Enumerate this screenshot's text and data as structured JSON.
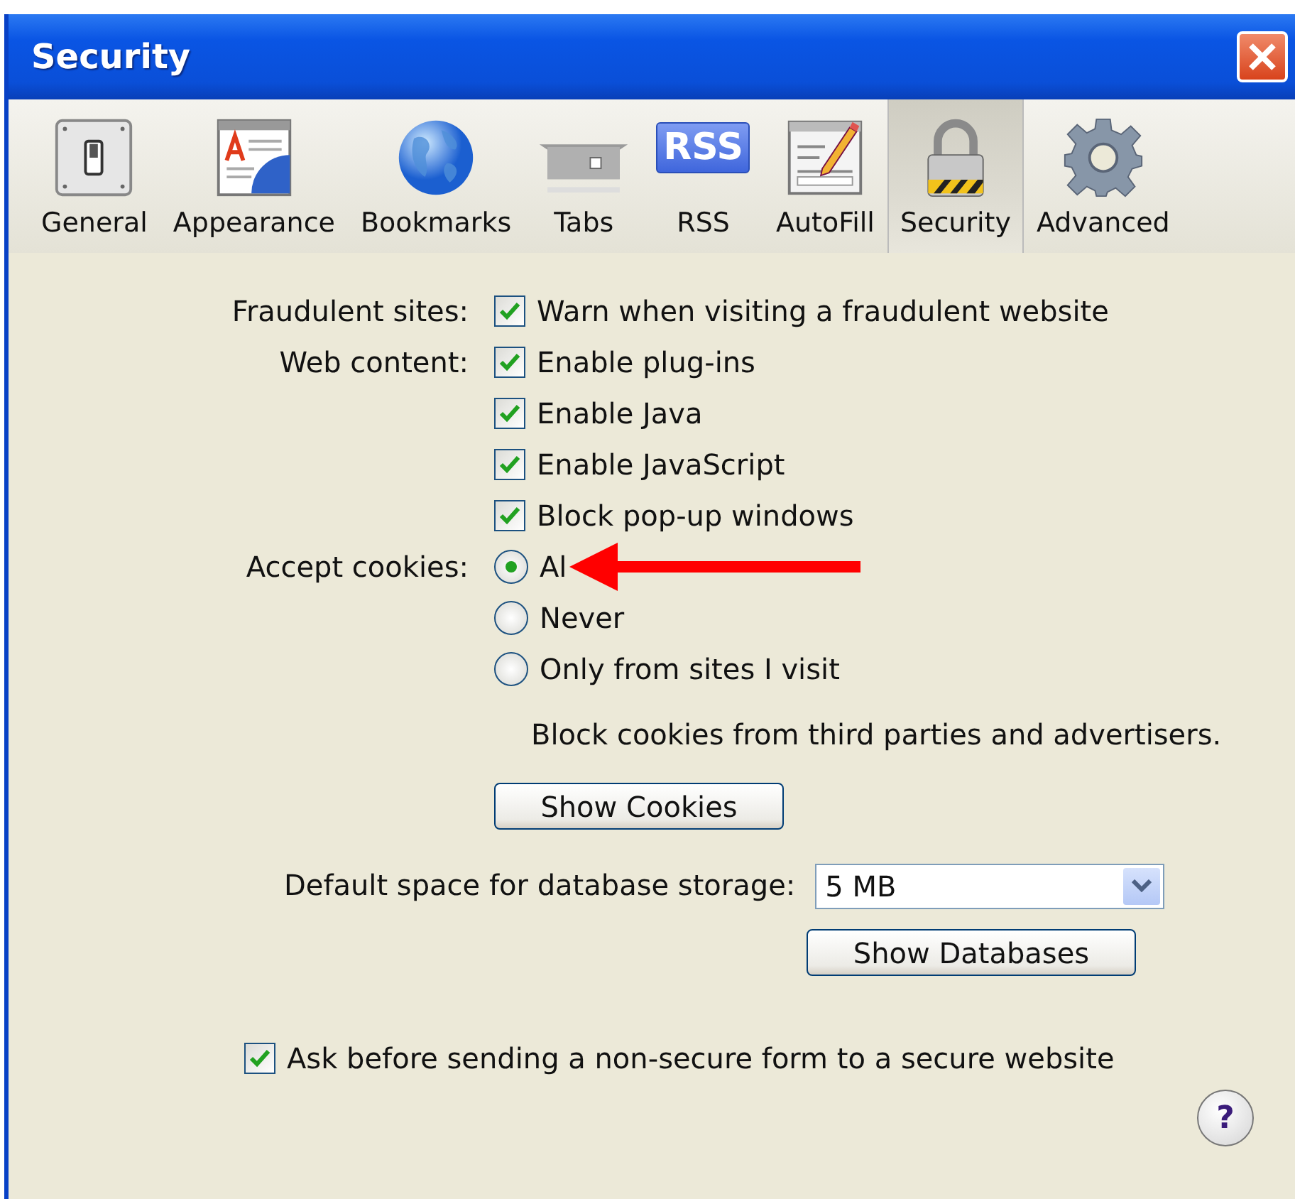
{
  "window": {
    "title": "Security"
  },
  "toolbar": [
    {
      "kind": "switch",
      "label": "General",
      "selected": false
    },
    {
      "kind": "appearance",
      "label": "Appearance",
      "selected": false
    },
    {
      "kind": "globe",
      "label": "Bookmarks",
      "selected": false
    },
    {
      "kind": "tray",
      "label": "Tabs",
      "selected": false
    },
    {
      "kind": "feed",
      "label": "RSS",
      "badge": "RSS",
      "selected": false
    },
    {
      "kind": "form",
      "label": "AutoFill",
      "selected": false
    },
    {
      "kind": "lock",
      "label": "Security",
      "selected": true
    },
    {
      "kind": "gear",
      "label": "Advanced",
      "selected": false
    }
  ],
  "fraudulent_sites": {
    "label": "Fraudulent sites:",
    "options": [
      {
        "label": "Warn when visiting a fraudulent website",
        "checked": true
      }
    ]
  },
  "web_content": {
    "label": "Web content:",
    "options": [
      {
        "label": "Enable plug-ins",
        "checked": true
      },
      {
        "label": "Enable Java",
        "checked": true
      },
      {
        "label": "Enable JavaScript",
        "checked": true
      },
      {
        "label": "Block pop-up windows",
        "checked": true
      }
    ]
  },
  "accept_cookies": {
    "label": "Accept cookies:",
    "options": [
      {
        "label": "Al",
        "selected": true
      },
      {
        "label": "Never",
        "selected": false
      },
      {
        "label": "Only from sites I visit",
        "selected": false
      }
    ],
    "note": "Block cookies from third parties and advertisers.",
    "button": "Show Cookies"
  },
  "database": {
    "label": "Default space for database storage:",
    "value": "5 MB",
    "button": "Show Databases"
  },
  "form_warning": {
    "label": "Ask before sending a non-secure form to a secure website",
    "checked": true
  },
  "help": {
    "label": "?"
  }
}
